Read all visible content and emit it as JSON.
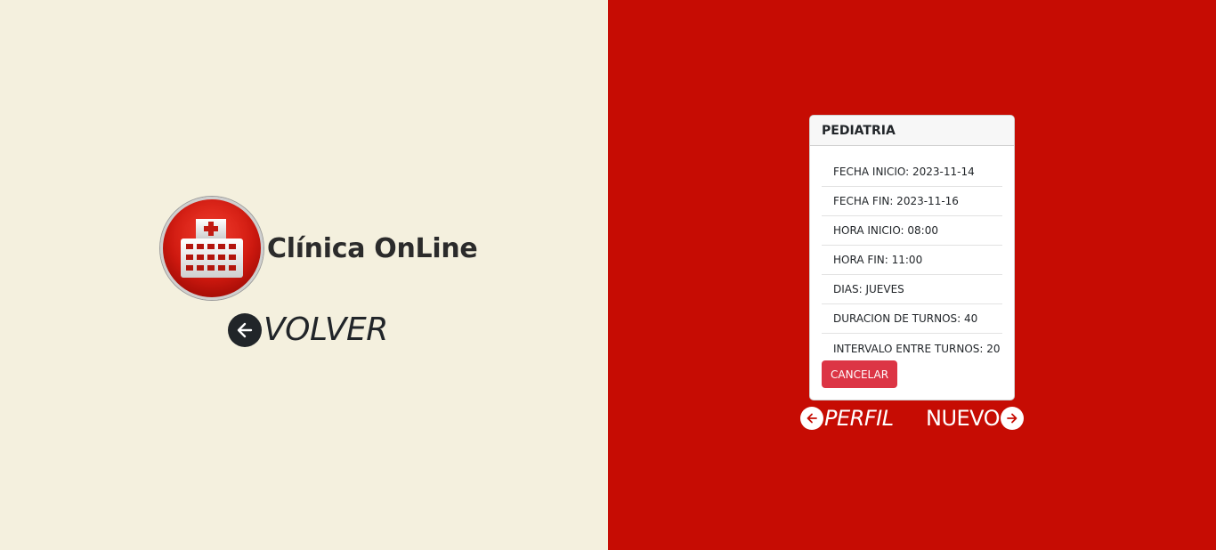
{
  "brand": {
    "name": "Clínica OnLine",
    "logo_icon": "hospital-building-icon"
  },
  "back_link": {
    "label": "VOLVER",
    "icon": "arrow-left-circle-icon"
  },
  "card": {
    "title": "PEDIATRIA",
    "items": [
      "FECHA INICIO: 2023-11-14",
      "FECHA FIN: 2023-11-16",
      "HORA INICIO: 08:00",
      "HORA FIN: 11:00",
      "DIAS: JUEVES",
      "DURACION DE TURNOS: 40",
      "INTERVALO ENTRE TURNOS: 20"
    ],
    "cancel_label": "CANCELAR"
  },
  "nav": {
    "prev_label": "PERFIL",
    "next_label": "NUEVO"
  },
  "colors": {
    "left_background": "#f4f0de",
    "right_background": "#c60c03",
    "cancel_button": "#dc3545",
    "dark_text": "#212529"
  }
}
